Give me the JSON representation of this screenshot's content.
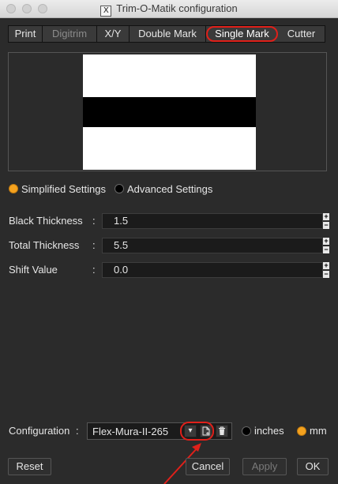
{
  "window": {
    "title": "Trim-O-Matik configuration",
    "icon": "x11-icon"
  },
  "tabs": [
    {
      "label": "Print",
      "state": "normal"
    },
    {
      "label": "Digitrim",
      "state": "disabled"
    },
    {
      "label": "X/Y",
      "state": "normal"
    },
    {
      "label": "Double Mark",
      "state": "normal"
    },
    {
      "label": "Single Mark",
      "state": "active"
    },
    {
      "label": "Cutter",
      "state": "normal"
    }
  ],
  "mode": {
    "simplified_label": "Simplified Settings",
    "advanced_label": "Advanced Settings",
    "selected": "simplified"
  },
  "params": [
    {
      "label": "Black Thickness",
      "colon": ":",
      "value": "1.5"
    },
    {
      "label": "Total Thickness",
      "colon": ":",
      "value": "5.5"
    },
    {
      "label": "Shift Value",
      "colon": ":",
      "value": "0.0"
    }
  ],
  "spinner": {
    "up": "+",
    "down": "−"
  },
  "configuration": {
    "label": "Configuration",
    "colon": ":",
    "value": "Flex-Mura-II-265",
    "units": {
      "inches_label": "inches",
      "mm_label": "mm",
      "selected": "mm"
    }
  },
  "buttons": {
    "reset": "Reset",
    "cancel": "Cancel",
    "apply": "Apply",
    "ok": "OK"
  },
  "colors": {
    "highlight": "#e0201a",
    "radio_selected": "#f4a21f",
    "background": "#2b2b2b"
  }
}
